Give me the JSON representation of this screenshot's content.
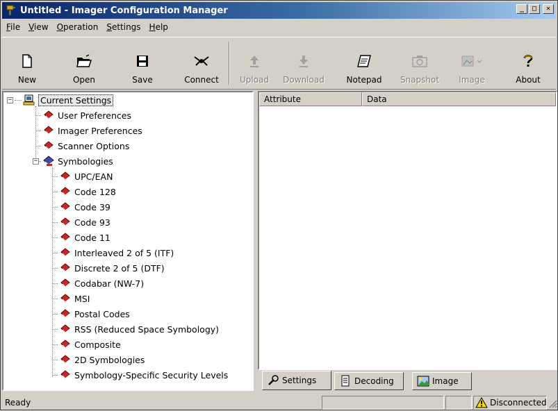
{
  "window": {
    "title": "Untitled - Imager Configuration Manager"
  },
  "menu": [
    {
      "label": "File",
      "u": "F",
      "rest": "ile"
    },
    {
      "label": "View",
      "u": "V",
      "rest": "iew"
    },
    {
      "label": "Operation",
      "u": "O",
      "rest": "peration"
    },
    {
      "label": "Settings",
      "u": "S",
      "rest": "ettings"
    },
    {
      "label": "Help",
      "u": "H",
      "rest": "elp"
    }
  ],
  "toolbar": {
    "new": "New",
    "open": "Open",
    "save": "Save",
    "connect": "Connect",
    "upload": "Upload",
    "download": "Download",
    "notepad": "Notepad",
    "snapshot": "Snapshot",
    "image": "Image",
    "about": "About"
  },
  "tree": {
    "root": "Current Settings",
    "items": [
      "User Preferences",
      "Imager Preferences",
      "Scanner Options"
    ],
    "symbologies": {
      "label": "Symbologies",
      "children": [
        "UPC/EAN",
        "Code 128",
        "Code 39",
        "Code 93",
        "Code 11",
        "Interleaved 2 of 5 (ITF)",
        "Discrete 2 of 5 (DTF)",
        "Codabar (NW-7)",
        "MSI",
        "Postal Codes",
        "RSS (Reduced Space Symbology)",
        "Composite",
        "2D Symbologies",
        "Symbology-Specific Security Levels"
      ]
    }
  },
  "list": {
    "columns": [
      "Attribute",
      "Data"
    ]
  },
  "tabs": [
    "Settings",
    "Decoding",
    "Image"
  ],
  "status": {
    "left": "Ready",
    "right": "Disconnected"
  },
  "colors": {
    "title_start": "#0a246a",
    "title_end": "#a6caf0",
    "face": "#d4d0c8",
    "book_red": "#c0282c"
  }
}
